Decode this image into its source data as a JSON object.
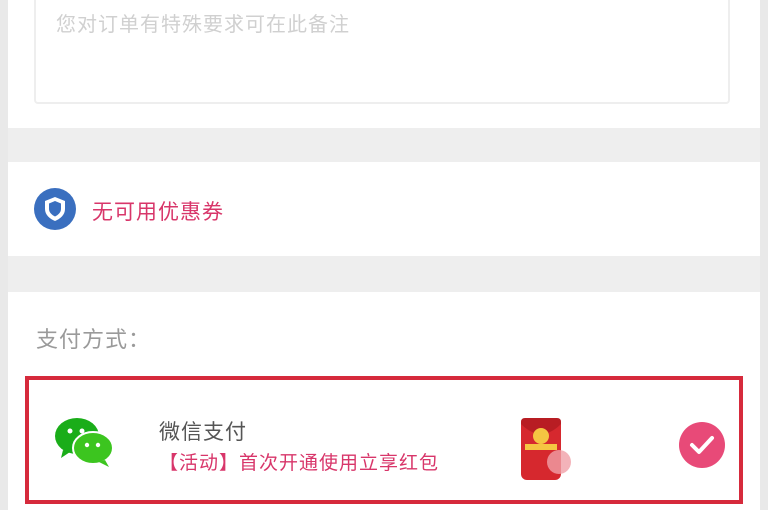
{
  "remark": {
    "placeholder": "您对订单有特殊要求可在此备注"
  },
  "coupon": {
    "icon": "coupon-icon",
    "text": "无可用优惠券"
  },
  "payment": {
    "section_label": "支付方式：",
    "selected_option": {
      "icon": "wechat-icon",
      "title": "微信支付",
      "promo": "【活动】首次开通使用立享红包",
      "promo_icon": "red-packet-icon",
      "selected": true,
      "check_icon": "check-icon"
    }
  },
  "colors": {
    "accent_pink": "#d8366a",
    "selection_border": "#d62a3c",
    "check_bg": "#e84a78",
    "wechat_green": "#1aad19",
    "coupon_blue": "#3a6fbf",
    "section_gap": "#eeeeee"
  }
}
